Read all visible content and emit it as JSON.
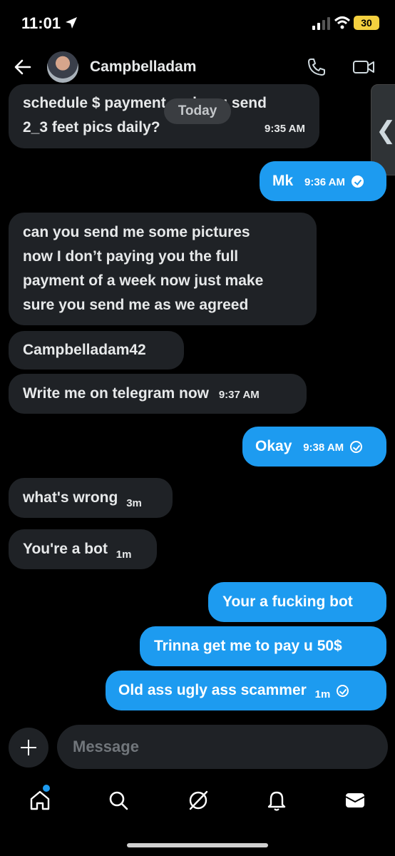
{
  "status": {
    "time": "11:01",
    "battery": "30"
  },
  "header": {
    "contact_name": "Campbelladam"
  },
  "today_label": "Today",
  "messages": [
    {
      "dir": "in",
      "lines": [
        "schedule $ payment and you send",
        "2_3 feet pics daily?"
      ],
      "time": "9:35 AM"
    },
    {
      "dir": "out",
      "text": "Mk",
      "time": "9:36 AM"
    },
    {
      "dir": "in",
      "lines": [
        "can you  send me some pictures",
        "now I don’t paying you the full",
        "payment of a week now just make",
        "sure you send me as we agreed"
      ]
    },
    {
      "dir": "in",
      "text": "Campbelladam42"
    },
    {
      "dir": "in",
      "text": "Write me on telegram now",
      "time": "9:37 AM"
    },
    {
      "dir": "out",
      "text": "Okay",
      "time": "9:38 AM"
    },
    {
      "dir": "in",
      "text": "what's wrong",
      "time": "3m"
    },
    {
      "dir": "in",
      "text": "You're a bot",
      "time": "1m"
    },
    {
      "dir": "out",
      "text": "Your a fucking bot"
    },
    {
      "dir": "out",
      "text": "Trinna get me to pay u 50$"
    },
    {
      "dir": "out",
      "text": "Old ass ugly ass scammer",
      "time": "1m"
    }
  ],
  "composer": {
    "placeholder": "Message"
  },
  "nav": {
    "icons": [
      "home-icon",
      "search-icon",
      "grok-icon",
      "notifications-icon",
      "messages-icon"
    ]
  },
  "colors": {
    "accent": "#1d9bf0",
    "incoming_bubble": "#1f2226",
    "background": "#000000"
  }
}
